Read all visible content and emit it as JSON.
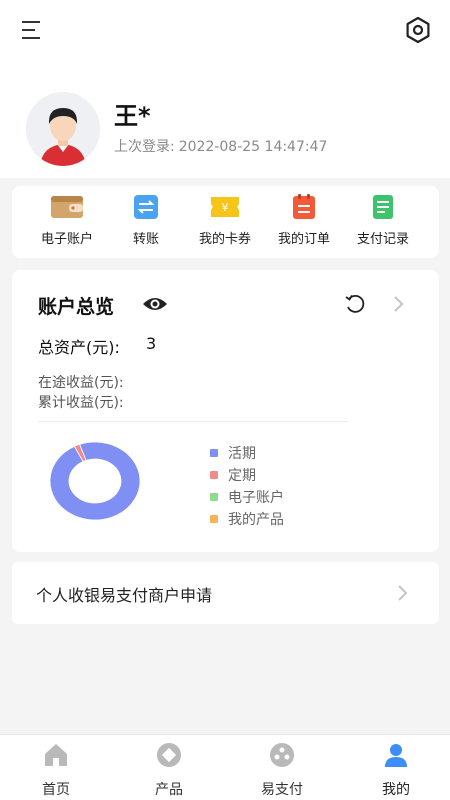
{
  "header": {
    "menu_icon": "hamburger-menu-icon",
    "settings_icon": "hexagon-settings-icon"
  },
  "profile": {
    "name": "王*",
    "last_login_label": "上次登录:",
    "last_login_time": "2022-08-25 14:47:47"
  },
  "quick_actions": [
    {
      "label": "电子账户",
      "icon": "wallet-icon",
      "color": "#c9955a"
    },
    {
      "label": "转账",
      "icon": "transfer-icon",
      "color": "#4aa3f0"
    },
    {
      "label": "我的卡券",
      "icon": "coupon-icon",
      "color": "#f5c51a"
    },
    {
      "label": "我的订单",
      "icon": "order-icon",
      "color": "#f25a3a"
    },
    {
      "label": "支付记录",
      "icon": "record-icon",
      "color": "#3cc36b"
    }
  ],
  "overview": {
    "title": "账户总览",
    "total_assets_label": "总资产(元):",
    "total_assets_value": "3",
    "in_transit_label": "在途收益(元):",
    "cumulative_label": "累计收益(元):",
    "legend": [
      {
        "label": "活期",
        "color": "#7f8ff4"
      },
      {
        "label": "定期",
        "color": "#f08b8b"
      },
      {
        "label": "电子账户",
        "color": "#8fdc8f"
      },
      {
        "label": "我的产品",
        "color": "#f5b458"
      }
    ],
    "share": [
      0.98,
      0.02,
      0,
      0
    ]
  },
  "apply": {
    "label": "个人收银易支付商户申请"
  },
  "tabbar": [
    {
      "label": "首页",
      "icon": "home-icon"
    },
    {
      "label": "产品",
      "icon": "product-icon"
    },
    {
      "label": "易支付",
      "icon": "pay-icon"
    },
    {
      "label": "我的",
      "icon": "user-icon",
      "active": true
    }
  ]
}
